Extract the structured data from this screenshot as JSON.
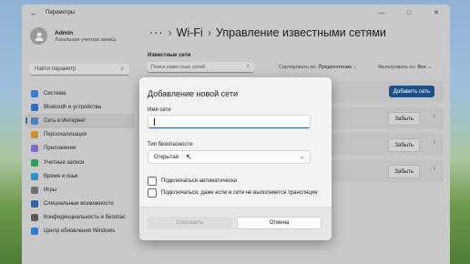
{
  "window": {
    "title": "Параметры",
    "back_icon": "arrow-left-icon",
    "controls": {
      "minimize": "—",
      "maximize": "□",
      "close": "✕"
    }
  },
  "profile": {
    "name": "Admin",
    "role": "Локальная учетная запись"
  },
  "sidebar": {
    "search_placeholder": "Найти параметр",
    "items": [
      {
        "label": "Система",
        "icon": "monitor-icon",
        "color": "#3a7bd5"
      },
      {
        "label": "Bluetooth и устройства",
        "icon": "bluetooth-icon",
        "color": "#2f6fc7"
      },
      {
        "label": "Сеть и Интернет",
        "icon": "network-icon",
        "color": "#4a7fbf",
        "active": true
      },
      {
        "label": "Персонализация",
        "icon": "brush-icon",
        "color": "#c9902a"
      },
      {
        "label": "Приложения",
        "icon": "apps-icon",
        "color": "#7a6fc8"
      },
      {
        "label": "Учетные записи",
        "icon": "person-icon",
        "color": "#2fa05a"
      },
      {
        "label": "Время и язык",
        "icon": "globe-icon",
        "color": "#2f8fd0"
      },
      {
        "label": "Игры",
        "icon": "gamepad-icon",
        "color": "#6f6f6f"
      },
      {
        "label": "Специальные возможности",
        "icon": "accessibility-icon",
        "color": "#2a66a8"
      },
      {
        "label": "Конфиденциальность и безопас",
        "icon": "shield-icon",
        "color": "#5a5a5a"
      },
      {
        "label": "Центр обновления Windows",
        "icon": "update-icon",
        "color": "#2a7fd0"
      }
    ]
  },
  "breadcrumb": {
    "overflow": "···",
    "parent": "Wi-Fi",
    "current": "Управление известными сетями"
  },
  "known_networks": {
    "label": "Известные сети",
    "search_placeholder": "Поиск известных сетей",
    "sort_label": "Сортировать по:",
    "sort_value": "Предпочтение",
    "filter_label": "Фильтровать по:",
    "filter_value": "Все",
    "add_button": "Добавить сеть",
    "forget_label": "Забыть"
  },
  "dialog": {
    "title": "Добавление новой сети",
    "name_label": "Имя сети",
    "name_value": "",
    "security_label": "Тип безопасности",
    "security_value": "Открытая",
    "auto_connect_label": "Подключаться автоматически",
    "hidden_connect_label": "Подключаться, даже если в сети не выполняется трансляция",
    "save_label": "Сохранить",
    "cancel_label": "Отмена"
  }
}
